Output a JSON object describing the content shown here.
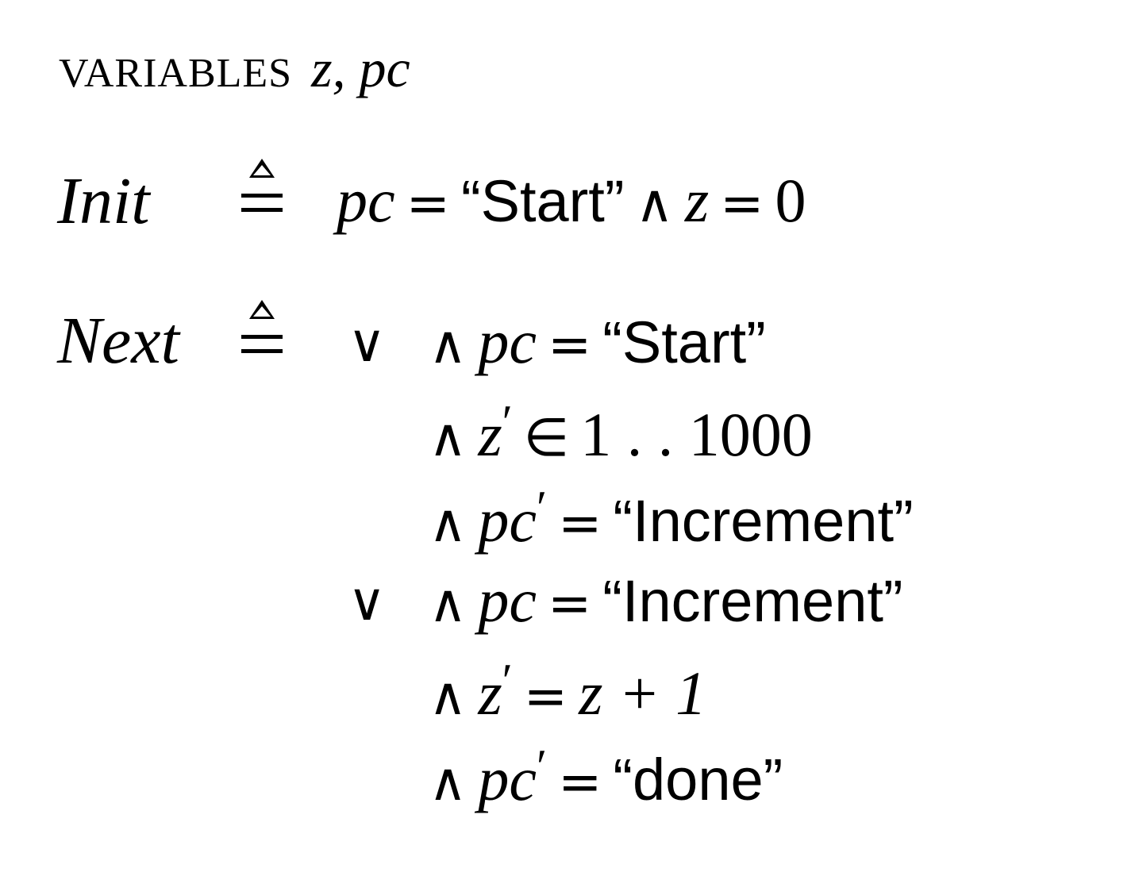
{
  "module": {
    "variables_keyword": "VARIABLES",
    "variables_list": "z, pc"
  },
  "init": {
    "name": "Init",
    "var_pc": "pc",
    "eq": "=",
    "start_value": "“Start”",
    "and": "∧",
    "var_z": "z",
    "zero": "0"
  },
  "next": {
    "name": "Next",
    "disjuncts": [
      {
        "or": "∨",
        "conjuncts": [
          {
            "and": "∧",
            "lhs": "pc",
            "prime": "",
            "op": "=",
            "rhs": "“Start”"
          },
          {
            "and": "∧",
            "lhs": "z",
            "prime": "′",
            "op": "∈",
            "rhs": "1 . . 1000"
          },
          {
            "and": "∧",
            "lhs": "pc",
            "prime": "′",
            "op": "=",
            "rhs": "“Increment”"
          }
        ]
      },
      {
        "or": "∨",
        "conjuncts": [
          {
            "and": "∧",
            "lhs": "pc",
            "prime": "",
            "op": "=",
            "rhs": "“Increment”"
          },
          {
            "and": "∧",
            "lhs": "z",
            "prime": "′",
            "op": "=",
            "rhs": "z + 1"
          },
          {
            "and": "∧",
            "lhs": "pc",
            "prime": "′",
            "op": "=",
            "rhs": "“done”"
          }
        ]
      }
    ]
  }
}
